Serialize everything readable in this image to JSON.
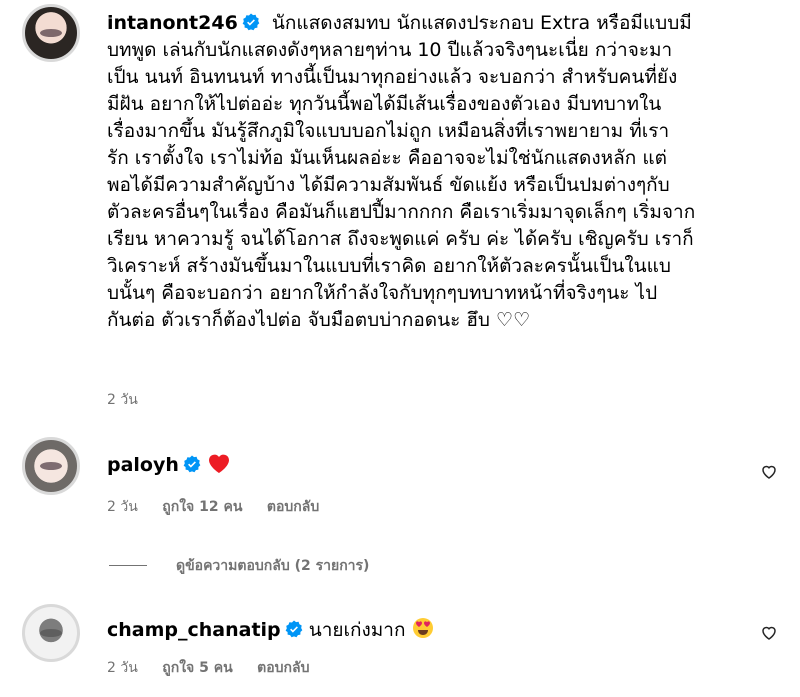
{
  "comments": [
    {
      "username": "intanont246",
      "text": "นักแสดงสมทบ นักแสดงประกอบ Extra หรือมีแบบมีบทพูด เล่นกับนักแสดงดังๆหลายๆท่าน 10 ปีแล้วจริงๆนะเนี่ย กว่าจะมาเป็น นนท์ อินทนนท์ ทางนี้เป็นมาทุกอย่างแล้ว จะบอกว่า สำหรับคนที่ยังมีฝัน อยากให้ไปต่ออ่ะ ทุกวันนี้พอได้มีเส้นเรื่องของตัวเอง มีบทบาทในเรื่องมากขึ้น มันรู้สึกภูมิใจแบบบอกไม่ถูก เหมือนสิ่งที่เราพยายาม ที่เรารัก เราตั้งใจ เราไม่ท้อ มันเห็นผลอ่ะะ คืออาจจะไม่ใช่นักแสดงหลัก แต่พอได้มีความสำคัญบ้าง ได้มีความสัมพันธ์ ขัดแย้ง หรือเป็นปมต่างๆกับตัวละครอื่นๆในเรื่อง คือมันก็แฮปปี้มากกกก คือเราเริ่มมาจุดเล็กๆ เริ่มจากเรียน หาความรู้ จนได้โอกาส ถึงจะพูดแค่ ครับ ค่ะ ได้ครับ เชิญครับ เราก็วิเคราะห์ สร้างมันขึ้นมาในแบบที่เราคิด อยากให้ตัวละครนั้นเป็นในแบบนั้นๆ คือจะบอกว่า อยากให้กำลังใจกับทุกๆบทบาทหน้าที่จริงๆนะ ไปกันต่อ ตัวเราก็ต้องไปต่อ จับมือตบบ่ากอดนะ ฮึบ ♡♡",
      "lines": [
        "นักแสดงสมทบ นักแสดงประกอบ Extra หรือมีแบบมี",
        "บทพูด เล่นกับนักแสดงดังๆหลายๆท่าน 10 ปีแล้วจริงๆนะเนี่ย กว่าจะมา",
        "เป็น นนท์ อินทนนท์ ทางนี้เป็นมาทุกอย่างแล้ว จะบอกว่า สำหรับคนที่ยัง",
        "มีฝัน อยากให้ไปต่ออ่ะ ทุกวันนี้พอได้มีเส้นเรื่องของตัวเอง มีบทบาทใน",
        "เรื่องมากขึ้น มันรู้สึกภูมิใจแบบบอกไม่ถูก เหมือนสิ่งที่เราพยายาม ที่เรา",
        "รัก เราตั้งใจ เราไม่ท้อ มันเห็นผลอ่ะะ คืออาจจะไม่ใช่นักแสดงหลัก แต่",
        "พอได้มีความสำคัญบ้าง ได้มีความสัมพันธ์ ขัดแย้ง หรือเป็นปมต่างๆกับ",
        "ตัวละครอื่นๆในเรื่อง คือมันก็แฮปปี้มากกกก คือเราเริ่มมาจุดเล็กๆ เริ่มจาก",
        "เรียน หาความรู้ จนได้โอกาส ถึงจะพูดแค่ ครับ ค่ะ ได้ครับ เชิญครับ เราก็",
        "วิเคราะห์ สร้างมันขึ้นมาในแบบที่เราคิด อยากให้ตัวละครนั้นเป็นในแบ",
        "บนั้นๆ คือจะบอกว่า อยากให้กำลังใจกับทุกๆบทบาทหน้าที่จริงๆนะ ไป",
        "กันต่อ ตัวเราก็ต้องไปต่อ จับมือตบบ่ากอดนะ ฮึบ ♡♡"
      ],
      "time": "2 วัน"
    },
    {
      "username": "paloyh",
      "text": "",
      "time": "2 วัน",
      "likes": "ถูกใจ 12 คน",
      "reply": "ตอบกลับ"
    },
    {
      "username": "champ_chanatip",
      "text": "นายเก่งมาก",
      "time": "2 วัน",
      "likes": "ถูกใจ 5 คน",
      "reply": "ตอบกลับ"
    }
  ],
  "view_replies": "ดูข้อความตอบกลับ (2 รายการ)",
  "colors": {
    "verified": "#0095f6",
    "muted": "#737373",
    "heart_red": "#ed1c24"
  },
  "icons": [
    "verified-badge-icon",
    "red-heart-emoji",
    "heart-eyes-emoji",
    "like-heart-icon"
  ]
}
